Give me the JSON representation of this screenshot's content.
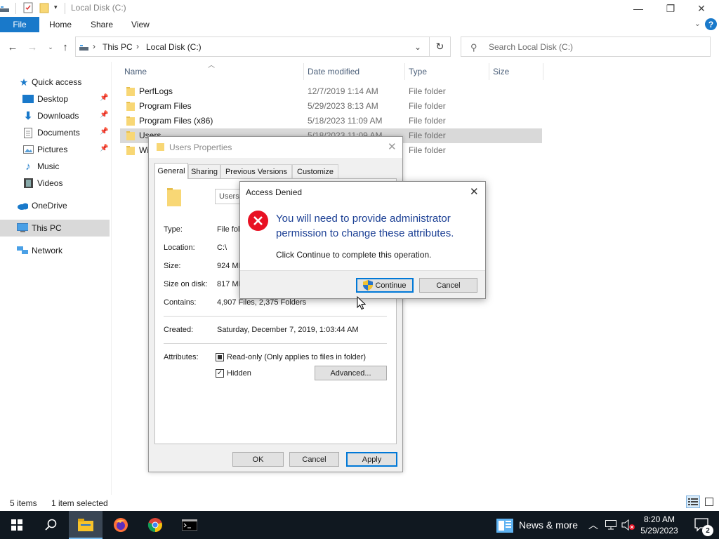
{
  "window": {
    "title": "Local Disk (C:)",
    "controls": {
      "minimize": "—",
      "maximize": "❐",
      "close": "✕"
    }
  },
  "ribbon": {
    "tabs": [
      "File",
      "Home",
      "Share",
      "View"
    ],
    "help": "?"
  },
  "address": {
    "crumbs": [
      "This PC",
      "Local Disk (C:)"
    ],
    "separator": "›",
    "search_placeholder": "Search Local Disk (C:)"
  },
  "nav": {
    "items": [
      {
        "label": "Quick access",
        "icon": "quick-access-star-icon"
      },
      {
        "label": "Desktop",
        "icon": "desktop-icon",
        "pinned": true
      },
      {
        "label": "Downloads",
        "icon": "downloads-icon",
        "pinned": true
      },
      {
        "label": "Documents",
        "icon": "documents-icon",
        "pinned": true
      },
      {
        "label": "Pictures",
        "icon": "pictures-icon",
        "pinned": true
      },
      {
        "label": "Music",
        "icon": "music-icon"
      },
      {
        "label": "Videos",
        "icon": "videos-icon"
      },
      {
        "label": "OneDrive",
        "icon": "onedrive-icon"
      },
      {
        "label": "This PC",
        "icon": "this-pc-icon",
        "selected": true
      },
      {
        "label": "Network",
        "icon": "network-icon"
      }
    ]
  },
  "columns": {
    "name": "Name",
    "date": "Date modified",
    "type": "Type",
    "size": "Size"
  },
  "files": [
    {
      "name": "PerfLogs",
      "date": "12/7/2019 1:14 AM",
      "type": "File folder"
    },
    {
      "name": "Program Files",
      "date": "5/29/2023 8:13 AM",
      "type": "File folder"
    },
    {
      "name": "Program Files (x86)",
      "date": "5/18/2023 11:09 AM",
      "type": "File folder"
    },
    {
      "name": "Users",
      "date": "5/18/2023 11:09 AM",
      "type": "File folder",
      "selected": true
    },
    {
      "name": "Wi",
      "date": "",
      "type": "File folder"
    }
  ],
  "status": {
    "items": "5 items",
    "selected": "1 item selected"
  },
  "properties": {
    "title": "Users Properties",
    "tabs": [
      "General",
      "Sharing",
      "Previous Versions",
      "Customize"
    ],
    "name_value": "Users",
    "labels": {
      "type": "Type:",
      "location": "Location:",
      "size": "Size:",
      "size_on_disk": "Size on disk:",
      "contains": "Contains:",
      "created": "Created:",
      "attributes": "Attributes:"
    },
    "values": {
      "type": "File fol",
      "location": "C:\\",
      "size": "924 MB",
      "size_on_disk": "817 MB",
      "contains": "4,907 Files, 2,375 Folders",
      "created": "Saturday, December 7, 2019, 1:03:44 AM"
    },
    "readonly_label": "Read-only (Only applies to files in folder)",
    "hidden_label": "Hidden",
    "hidden_checked": "✓",
    "advanced_label": "Advanced...",
    "ok_label": "OK",
    "cancel_label": "Cancel",
    "apply_label": "Apply"
  },
  "access_denied": {
    "title": "Access Denied",
    "message": "You will need to provide administrator permission to change these attributes.",
    "sub": "Click Continue to complete this operation.",
    "continue_label": "Continue",
    "cancel_label": "Cancel"
  },
  "taskbar": {
    "news_label": "News & more",
    "time": "8:20 AM",
    "date": "5/29/2023",
    "notification_count": "2"
  },
  "colors": {
    "accent": "#1979ca",
    "error_red": "#e81123",
    "message_blue": "#1b3f94",
    "taskbar_bg": "#101820",
    "folder_yellow": "#f8d775"
  }
}
